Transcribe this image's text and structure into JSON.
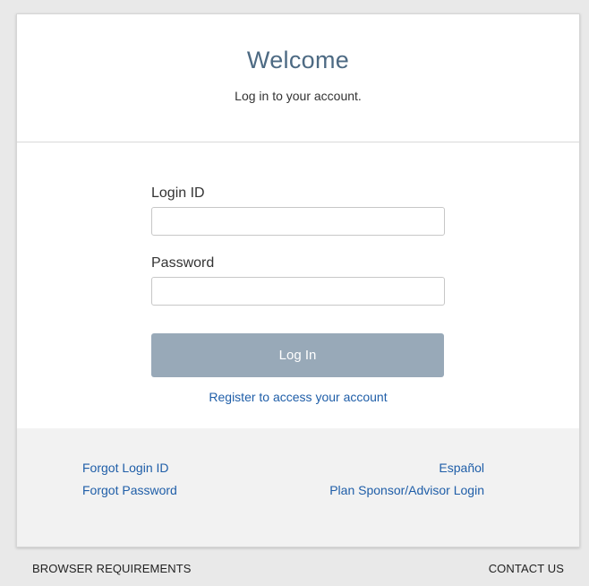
{
  "header": {
    "title": "Welcome",
    "subtitle": "Log in to your account."
  },
  "form": {
    "login_id_label": "Login ID",
    "login_id_value": "",
    "password_label": "Password",
    "password_value": "",
    "submit_label": "Log In",
    "submit_color": "#98a9b8"
  },
  "register_link": "Register to access your account",
  "footer": {
    "forgot_login_id": "Forgot Login ID",
    "forgot_password": "Forgot Password",
    "espanol": "Español",
    "plan_sponsor_login": "Plan Sponsor/Advisor Login"
  },
  "bottom_bar": {
    "browser_requirements": "BROWSER REQUIREMENTS",
    "contact_us": "CONTACT US"
  },
  "colors": {
    "link": "#1f5ea8",
    "title": "#4d6a83",
    "background": "#e9e9e9"
  }
}
